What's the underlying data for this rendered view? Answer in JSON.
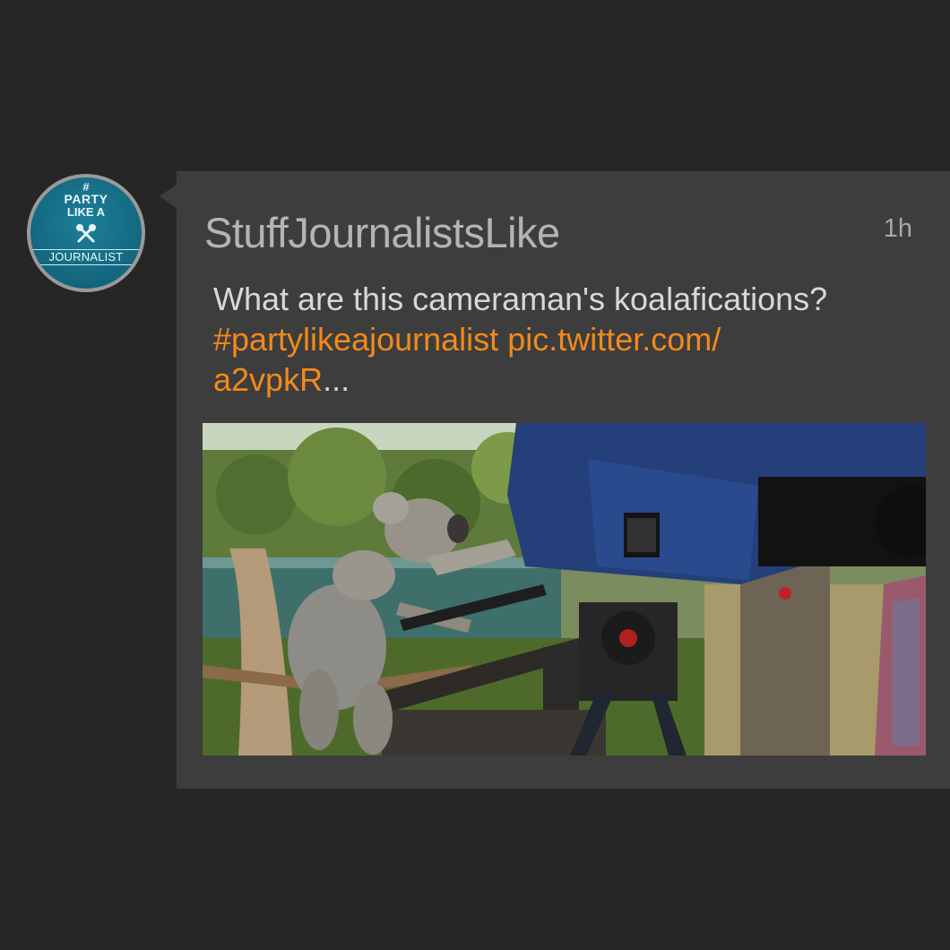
{
  "avatar": {
    "hash": "#",
    "line1": "PARTY",
    "line2": "LIKE A",
    "line3": "JOURNALIST",
    "icon": "microphone-icon"
  },
  "tweet": {
    "username": "StuffJournalistsLike",
    "timestamp": "1h",
    "text": "What are this cameraman's koalafications?",
    "hashtag": "#partylikeajournalist",
    "link_part1": "pic.twitter.com/",
    "link_part2": "a2vpkR",
    "ellipsis": "...",
    "image_subject": "koala-with-camera-photo"
  },
  "colors": {
    "background": "#262626",
    "card": "#3d3d3d",
    "username": "#b4b4b4",
    "text": "#d8d8d8",
    "link": "#f28a1a",
    "avatar_bg": "#146a82"
  }
}
